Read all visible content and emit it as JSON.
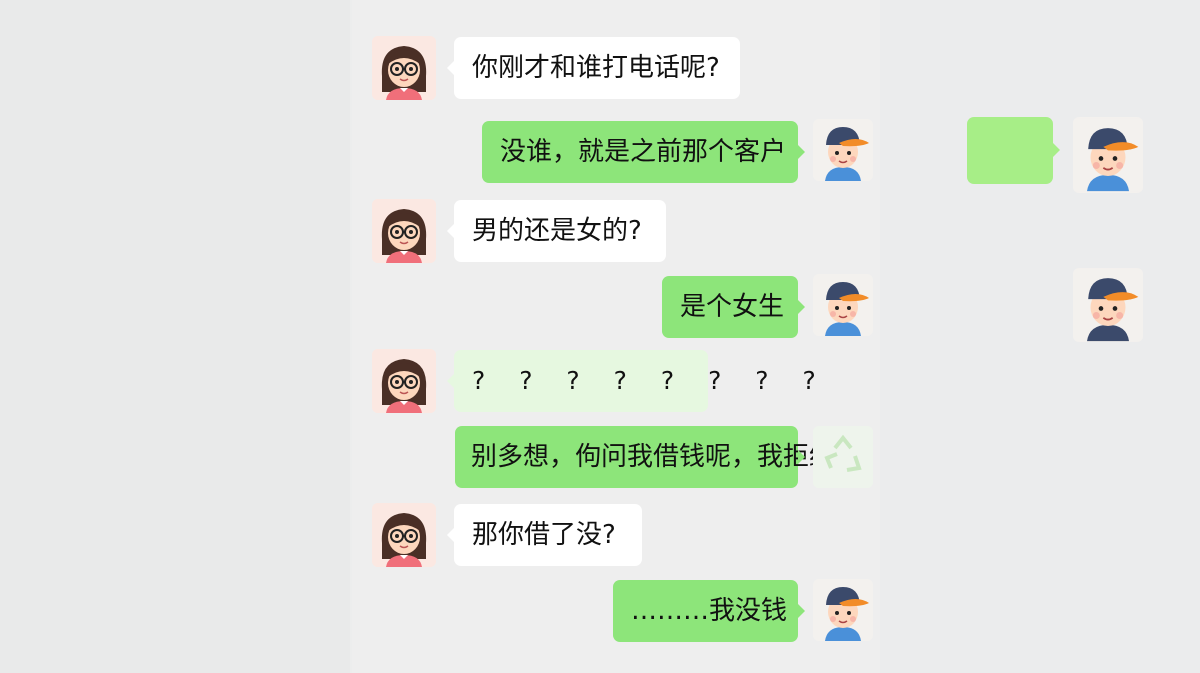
{
  "messages": [
    {
      "sender": "girl",
      "side": "left",
      "text": "你刚才和谁打电话呢?"
    },
    {
      "sender": "boy",
      "side": "right",
      "text": "没谁，就是之前那个客户"
    },
    {
      "sender": "girl",
      "side": "left",
      "text": "男的还是女的?"
    },
    {
      "sender": "boy",
      "side": "right",
      "text": "是个女生"
    },
    {
      "sender": "girl",
      "side": "left",
      "text": "? ? ?  ? ? ? ? ?"
    },
    {
      "sender": "boy",
      "side": "right",
      "text": "别多想，佝问我借钱呢，我拒绝了"
    },
    {
      "sender": "girl",
      "side": "left",
      "text": "那你借了没?"
    },
    {
      "sender": "boy",
      "side": "right",
      "text": "………我没钱"
    }
  ],
  "avatars": {
    "girl": "girl-with-glasses-avatar-icon",
    "boy": "boy-with-cap-avatar-icon"
  },
  "colors": {
    "page_background": "#eceded",
    "incoming_bubble": "#ffffff",
    "outgoing_bubble": "#8de57a",
    "ghost_bubble": "#a7ee87"
  }
}
